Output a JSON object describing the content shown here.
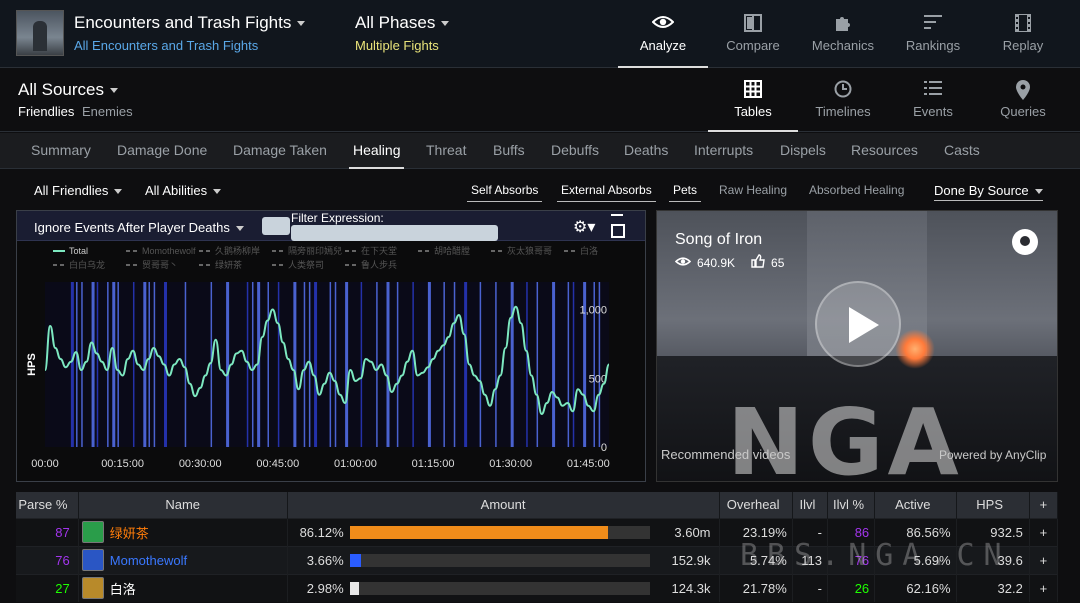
{
  "header": {
    "encounter_title": "Encounters and Trash Fights",
    "encounter_sub": "All Encounters and Trash Fights",
    "phase_title": "All Phases",
    "phase_sub": "Multiple Fights",
    "nav": [
      {
        "label": "Analyze",
        "icon": "eye-icon"
      },
      {
        "label": "Compare",
        "icon": "compare-icon"
      },
      {
        "label": "Mechanics",
        "icon": "puzzle-icon"
      },
      {
        "label": "Rankings",
        "icon": "rankings-icon"
      },
      {
        "label": "Replay",
        "icon": "film-icon"
      }
    ]
  },
  "sources": {
    "title": "All Sources",
    "friendlies": "Friendlies",
    "enemies": "Enemies",
    "views": [
      {
        "label": "Tables",
        "icon": "grid-icon"
      },
      {
        "label": "Timelines",
        "icon": "clock-icon"
      },
      {
        "label": "Events",
        "icon": "list-icon"
      },
      {
        "label": "Queries",
        "icon": "location-icon"
      }
    ]
  },
  "tabs": [
    "Summary",
    "Damage Done",
    "Damage Taken",
    "Healing",
    "Threat",
    "Buffs",
    "Debuffs",
    "Deaths",
    "Interrupts",
    "Dispels",
    "Resources",
    "Casts"
  ],
  "filters": {
    "friendlies": "All Friendlies",
    "abilities": "All Abilities",
    "chips": [
      "Self Absorbs",
      "External Absorbs",
      "Pets",
      "Raw Healing",
      "Absorbed Healing"
    ],
    "done_by": "Done By Source"
  },
  "chart_panel": {
    "ignore_label": "Ignore Events After Player Deaths",
    "filter_label": "Filter Expression:",
    "filter_value": ""
  },
  "chart_data": {
    "type": "line",
    "ylabel": "HPS",
    "ylim": [
      0,
      1200
    ],
    "yticks": [
      "0",
      "500",
      "1,000"
    ],
    "xticks": [
      "00:00",
      "00:15:00",
      "00:30:00",
      "00:45:00",
      "01:00:00",
      "01:15:00",
      "01:30:00",
      "01:45:00"
    ],
    "legend": [
      "Total",
      "Momothewolf",
      "久鹅杨柳岸",
      "隔旁丽印嫣兒",
      "在下天堂",
      "胡哈醋膛",
      "灰太狼哥哥",
      "白洛",
      "白白乌龙",
      "贸哥哥丶",
      "绿妍茶",
      "人类祭司",
      "鲁人步兵"
    ],
    "series": [
      {
        "name": "Total",
        "color": "#7de8c0",
        "x_minutes": [
          0,
          1,
          2,
          3,
          4,
          5,
          6,
          7,
          8,
          9,
          10,
          11,
          12,
          13,
          14,
          15,
          16,
          17,
          18,
          19,
          20,
          21,
          22,
          23,
          24,
          25,
          26,
          27,
          28,
          29,
          30,
          31,
          32,
          33,
          34,
          35,
          36,
          37,
          38,
          39,
          40,
          41,
          42,
          43,
          44,
          45,
          46,
          47,
          48,
          49,
          50,
          51,
          52,
          53,
          54,
          55,
          56,
          57,
          58,
          59,
          60,
          61,
          62,
          63,
          64,
          65,
          66,
          67,
          68,
          69,
          70,
          71,
          72,
          73,
          74,
          75,
          76,
          77,
          78,
          79,
          80,
          81,
          82,
          83,
          84,
          85,
          86,
          87,
          88,
          89,
          90,
          91,
          92,
          93,
          94,
          95,
          96,
          97,
          98,
          99,
          100,
          101,
          102,
          103,
          104,
          105,
          106,
          107,
          108,
          109
        ],
        "values": [
          560,
          880,
          720,
          640,
          580,
          620,
          690,
          560,
          620,
          760,
          680,
          620,
          560,
          720,
          560,
          520,
          640,
          700,
          600,
          560,
          640,
          720,
          660,
          600,
          520,
          600,
          640,
          580,
          460,
          370,
          430,
          520,
          610,
          780,
          560,
          520,
          600,
          680,
          700,
          620,
          560,
          600,
          800,
          920,
          1000,
          900,
          760,
          640,
          560,
          420,
          560,
          620,
          520,
          380,
          460,
          540,
          480,
          380,
          320,
          560,
          480,
          500,
          640,
          620,
          560,
          600,
          520,
          400,
          460,
          520,
          620,
          700,
          520,
          540,
          580,
          640,
          700,
          740,
          800,
          900,
          960,
          820,
          600,
          520,
          480,
          380,
          300,
          420,
          520,
          720,
          940,
          1020,
          900,
          700,
          520,
          380,
          240,
          320,
          400,
          360,
          300,
          320,
          260,
          420,
          380,
          300,
          260,
          380,
          460,
          600
        ]
      }
    ],
    "band_minutes": [
      5,
      6,
      7,
      9,
      10,
      12,
      13,
      14,
      17,
      19,
      20,
      21,
      23,
      27,
      32,
      35,
      39,
      40,
      41,
      43,
      45,
      48,
      50,
      51,
      52,
      55,
      56,
      58,
      61,
      64,
      66,
      68,
      71,
      74,
      77,
      79,
      81,
      84,
      87,
      90,
      93,
      95,
      98,
      101,
      102,
      104,
      106,
      107
    ]
  },
  "video": {
    "title": "Song of Iron",
    "views": "640.9K",
    "likes": "65",
    "recommended": "Recommended videos",
    "powered": "Powered by AnyClip",
    "watermark": "NGA"
  },
  "table": {
    "headers": [
      "Parse %",
      "Name",
      "Amount",
      "Overheal",
      "Ilvl",
      "Ilvl %",
      "Active",
      "HPS",
      "+"
    ],
    "rows": [
      {
        "parse": "87",
        "parse_color": "#a335ee",
        "name": "绿妍茶",
        "name_color": "#ff7d0a",
        "spec_color": "#2a9d4a",
        "pct": "86.12%",
        "pct_value": 86.12,
        "bar_color": "#f08c1a",
        "amount": "3.60m",
        "overheal": "23.19%",
        "ilvl": "-",
        "ilvl_pct": "86",
        "ilvl_pct_color": "#a335ee",
        "active": "86.56%",
        "hps": "932.5",
        "plus": "+"
      },
      {
        "parse": "76",
        "parse_color": "#a335ee",
        "name": "Momothewolf",
        "name_color": "#3a78ff",
        "spec_color": "#2a56c4",
        "pct": "3.66%",
        "pct_value": 3.66,
        "bar_color": "#2a5cff",
        "amount": "152.9k",
        "overheal": "5.74%",
        "ilvl": "113",
        "ilvl_pct": "76",
        "ilvl_pct_color": "#a335ee",
        "active": "5.69%",
        "hps": "39.6",
        "plus": "+"
      },
      {
        "parse": "27",
        "parse_color": "#1eff00",
        "name": "白洛",
        "name_color": "#ffffff",
        "spec_color": "#b88a2a",
        "pct": "2.98%",
        "pct_value": 2.98,
        "bar_color": "#e8e8e8",
        "amount": "124.3k",
        "overheal": "21.78%",
        "ilvl": "-",
        "ilvl_pct": "26",
        "ilvl_pct_color": "#1eff00",
        "active": "62.16%",
        "hps": "32.2",
        "plus": "+"
      }
    ]
  },
  "watermark_bbs": "BBS.NGA.CN"
}
